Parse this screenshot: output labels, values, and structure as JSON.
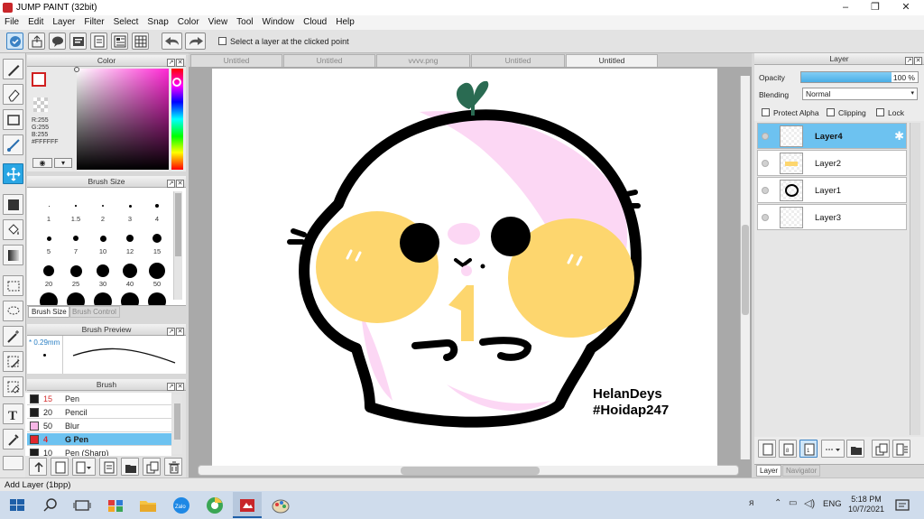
{
  "window": {
    "title": "JUMP PAINT (32bit)",
    "min": "–",
    "max": "❐",
    "close": "✕"
  },
  "menu": [
    "File",
    "Edit",
    "Layer",
    "Filter",
    "Select",
    "Snap",
    "Color",
    "View",
    "Tool",
    "Window",
    "Cloud",
    "Help"
  ],
  "toolbar": {
    "select_layer_label": "Select a layer at the clicked point"
  },
  "color_panel": {
    "title": "Color",
    "rgb_r": "R:255",
    "rgb_g": "G:255",
    "rgb_b": "B:255",
    "hex": "#FFFFFF"
  },
  "brush_size_panel": {
    "title": "Brush Size",
    "rows": [
      [
        "1",
        "1.5",
        "2",
        "3",
        "4"
      ],
      [
        "5",
        "7",
        "10",
        "12",
        "15"
      ],
      [
        "20",
        "25",
        "30",
        "40",
        "50"
      ]
    ],
    "tab_active": "Brush Size",
    "tab_inactive": "Brush Control"
  },
  "brush_preview_panel": {
    "title": "Brush Preview",
    "size": "* 0.29mm"
  },
  "brush_panel": {
    "title": "Brush",
    "items": [
      {
        "size": "15",
        "name": "Pen",
        "color": "#1e1e1e",
        "size_color": "#d43030"
      },
      {
        "size": "20",
        "name": "Pencil",
        "color": "#1e1e1e",
        "size_color": "#222"
      },
      {
        "size": "50",
        "name": "Blur",
        "color": "#f7b6e6",
        "size_color": "#222"
      },
      {
        "size": "4",
        "name": "G Pen",
        "color": "#e0282e",
        "size_color": "#e0282e",
        "active": true
      },
      {
        "size": "10",
        "name": "Pen (Sharp)",
        "color": "#1e1e1e",
        "size_color": "#222"
      }
    ]
  },
  "tabs": [
    "Untitled",
    "Untitled",
    "vvvv.png",
    "Untitled",
    "Untitled"
  ],
  "artwork": {
    "signature_line1": "HelanDeys",
    "signature_line2": "#Hoidap247"
  },
  "layer_panel": {
    "title": "Layer",
    "opacity_label": "Opacity",
    "opacity_value": "100 %",
    "blending_label": "Blending",
    "blending_value": "Normal",
    "protect_alpha": "Protect Alpha",
    "clipping": "Clipping",
    "lock": "Lock",
    "layers": [
      "Layer4",
      "Layer2",
      "Layer1",
      "Layer3"
    ],
    "tab_layer": "Layer",
    "tab_navigator": "Navigator"
  },
  "status": {
    "text": "Add Layer (1bpp)"
  },
  "taskbar": {
    "lang": "ENG",
    "time": "5:18 PM",
    "date": "10/7/2021"
  },
  "colors": {
    "accent": "#29a6e4",
    "active_row": "#6dc2f0"
  }
}
